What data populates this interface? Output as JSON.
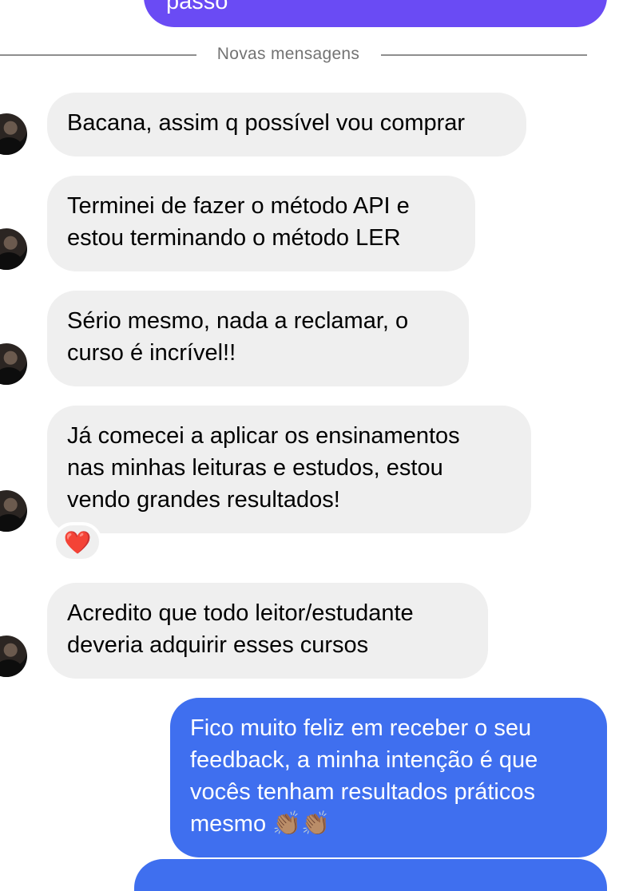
{
  "top_message": {
    "text": "passo"
  },
  "divider": {
    "label": "Novas mensagens"
  },
  "messages": [
    {
      "text": "Bacana, assim q possível vou comprar"
    },
    {
      "text": "Terminei de fazer o método API e\nestou terminando o método LER"
    },
    {
      "text": "Sério mesmo, nada a reclamar, o\ncurso é incrível!!"
    },
    {
      "text": "Já comecei a aplicar os ensinamentos\nnas minhas leituras e estudos, estou\nvendo grandes resultados!"
    },
    {
      "text": "Acredito que todo leitor/estudante\ndeveria adquirir esses cursos"
    }
  ],
  "reaction": {
    "emoji": "❤️"
  },
  "reply": {
    "text": "Fico muito feliz em receber o seu\nfeedback, a minha intenção é que\nvocês tenham resultados práticos\nmesmo 👏🏽👏🏽"
  }
}
